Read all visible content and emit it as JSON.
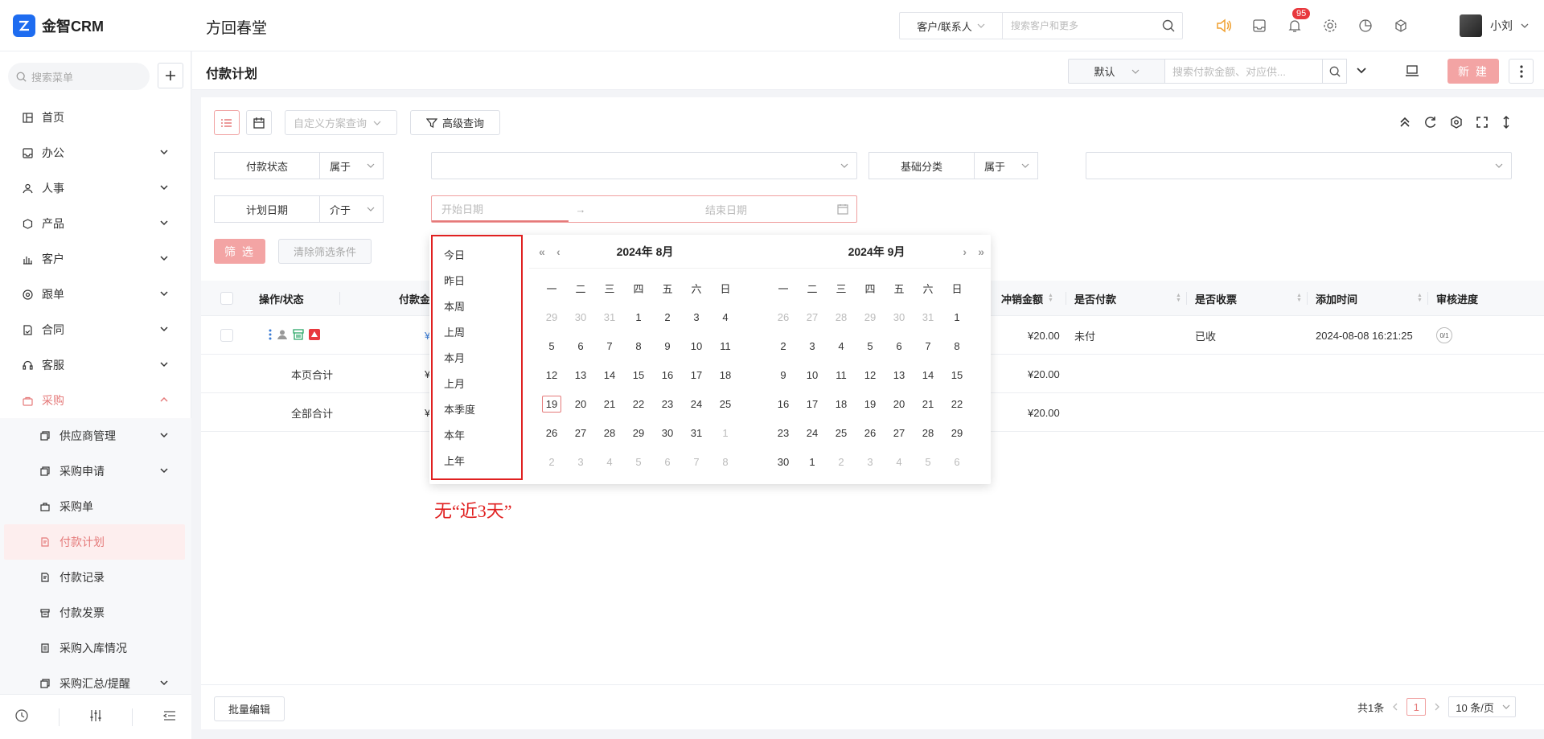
{
  "app": {
    "name": "金智CRM",
    "company": "方回春堂"
  },
  "global_search": {
    "scope": "客户/联系人",
    "placeholder": "搜索客户和更多"
  },
  "notifications": {
    "count": "95"
  },
  "user": {
    "name": "小刘"
  },
  "sidebar": {
    "search_placeholder": "搜索菜单",
    "items": [
      {
        "label": "首页",
        "icon": "home-icon"
      },
      {
        "label": "办公",
        "icon": "office-icon"
      },
      {
        "label": "人事",
        "icon": "people-icon"
      },
      {
        "label": "产品",
        "icon": "product-icon"
      },
      {
        "label": "客户",
        "icon": "customer-icon"
      },
      {
        "label": "跟单",
        "icon": "follow-icon"
      },
      {
        "label": "合同",
        "icon": "contract-icon"
      },
      {
        "label": "客服",
        "icon": "service-icon"
      },
      {
        "label": "采购",
        "icon": "purchase-icon"
      }
    ],
    "sub_items": [
      {
        "label": "供应商管理"
      },
      {
        "label": "采购申请"
      },
      {
        "label": "采购单"
      },
      {
        "label": "付款计划"
      },
      {
        "label": "付款记录"
      },
      {
        "label": "付款发票"
      },
      {
        "label": "采购入库情况"
      },
      {
        "label": "采购汇总/提醒"
      }
    ]
  },
  "page": {
    "title": "付款计划",
    "view_select": "默认",
    "search_placeholder": "搜索付款金额、对应供...",
    "new_label": "新 建"
  },
  "toolbar": {
    "scheme_placeholder": "自定义方案查询",
    "advanced_label": "高级查询"
  },
  "filters": {
    "status_label": "付款状态",
    "status_op": "属于",
    "category_label": "基础分类",
    "category_op": "属于",
    "date_label": "计划日期",
    "date_op": "介于",
    "start_placeholder": "开始日期",
    "end_placeholder": "结束日期",
    "filter_btn": "筛 选",
    "clear_btn": "清除筛选条件"
  },
  "table": {
    "headers": {
      "action": "操作/状态",
      "amount": "付款金",
      "writeoff": "冲销金额",
      "paid": "是否付款",
      "invoice": "是否收票",
      "added": "添加时间",
      "audit": "审核进度"
    },
    "row": {
      "amount": "¥",
      "writeoff": "¥20.00",
      "paid": "未付",
      "invoice": "已收",
      "added": "2024-08-08 16:21:25",
      "audit": "0/1"
    },
    "page_total": {
      "label": "本页合计",
      "amount": "¥",
      "writeoff": "¥20.00"
    },
    "all_total": {
      "label": "全部合计",
      "amount": "¥",
      "writeoff": "¥20.00"
    }
  },
  "footer": {
    "bulk_edit": "批量编辑",
    "total": "共1条",
    "current_page": "1",
    "page_size": "10 条/页"
  },
  "picker": {
    "presets": [
      "今日",
      "昨日",
      "本周",
      "上周",
      "本月",
      "上月",
      "本季度",
      "本年",
      "上年"
    ],
    "weekdays": [
      "一",
      "二",
      "三",
      "四",
      "五",
      "六",
      "日"
    ],
    "left_title": "2024年  8月",
    "right_title": "2024年  9月",
    "left_days": [
      "29",
      "30",
      "31",
      "1",
      "2",
      "3",
      "4",
      "5",
      "6",
      "7",
      "8",
      "9",
      "10",
      "11",
      "12",
      "13",
      "14",
      "15",
      "16",
      "17",
      "18",
      "19",
      "20",
      "21",
      "22",
      "23",
      "24",
      "25",
      "26",
      "27",
      "28",
      "29",
      "30",
      "31",
      "1",
      "2",
      "3",
      "4",
      "5",
      "6",
      "7",
      "8"
    ],
    "right_days": [
      "26",
      "27",
      "28",
      "29",
      "30",
      "31",
      "1",
      "2",
      "3",
      "4",
      "5",
      "6",
      "7",
      "8",
      "9",
      "10",
      "11",
      "12",
      "13",
      "14",
      "15",
      "16",
      "17",
      "18",
      "19",
      "20",
      "21",
      "22",
      "23",
      "24",
      "25",
      "26",
      "27",
      "28",
      "29",
      "30",
      "1",
      "2",
      "3",
      "4",
      "5",
      "6"
    ],
    "left_muted": [
      0,
      1,
      2,
      34,
      35,
      36,
      37,
      38,
      39,
      40,
      41
    ],
    "right_muted": [
      0,
      1,
      2,
      3,
      4,
      5,
      37,
      38,
      39,
      40,
      41
    ],
    "today_index": 21
  },
  "annotation": "无“近3天”"
}
